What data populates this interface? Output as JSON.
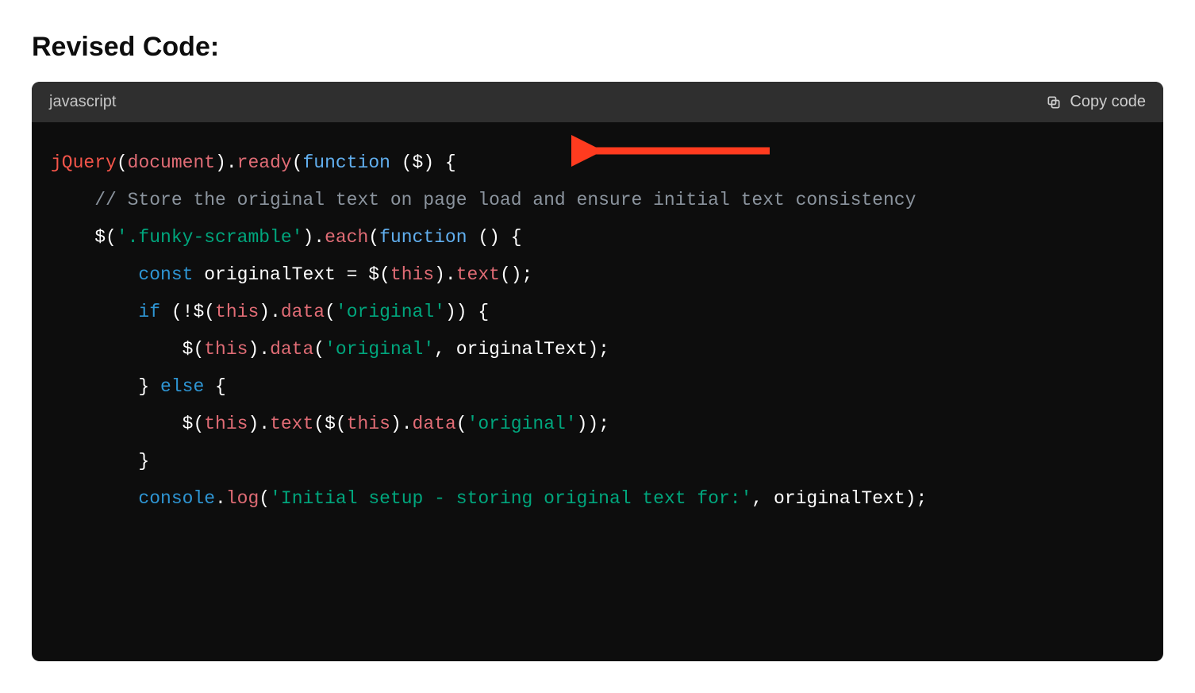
{
  "heading": "Revised Code:",
  "codeHeader": {
    "language": "javascript",
    "copyLabel": "Copy code"
  },
  "code": {
    "line1": {
      "jquery": "jQuery",
      "p1": "(",
      "doc": "document",
      "p2": ").",
      "ready": "ready",
      "p3": "(",
      "func": "function",
      "p4": " ($) {"
    },
    "line2": {
      "indent": "    ",
      "comment": "// Store the original text on page load and ensure initial text consistency"
    },
    "line3": {
      "indent": "    ",
      "dollar": "$(",
      "sel": "'.funky-scramble'",
      "p1": ").",
      "each": "each",
      "p2": "(",
      "func": "function",
      "p3": " () {"
    },
    "line4": {
      "indent": "        ",
      "const": "const",
      "p1": " originalText = $(",
      "this": "this",
      "p2": ").",
      "text": "text",
      "p3": "();"
    },
    "line5": {
      "indent": "        ",
      "if": "if",
      "p1": " (!$(",
      "this": "this",
      "p2": ").",
      "data": "data",
      "p3": "(",
      "str": "'original'",
      "p4": ")) {"
    },
    "line6": {
      "indent": "            ",
      "p1": "$(",
      "this": "this",
      "p2": ").",
      "data": "data",
      "p3": "(",
      "str": "'original'",
      "p4": ", originalText);"
    },
    "line7": {
      "indent": "        ",
      "p1": "} ",
      "else": "else",
      "p2": " {"
    },
    "line8": {
      "indent": "            ",
      "p1": "$(",
      "this1": "this",
      "p2": ").",
      "text": "text",
      "p3": "($(",
      "this2": "this",
      "p4": ").",
      "data": "data",
      "p5": "(",
      "str": "'original'",
      "p6": "));"
    },
    "line9": {
      "indent": "        ",
      "p1": "}"
    },
    "line10": {
      "indent": "        ",
      "console": "console",
      "p1": ".",
      "log": "log",
      "p2": "(",
      "str": "'Initial setup - storing original text for:'",
      "p3": ", originalText);"
    }
  },
  "annotation": {
    "type": "arrow",
    "color": "#ff3b1f",
    "direction": "left",
    "pointsTo": "line 1 — jQuery(document).ready(function ($) {"
  }
}
